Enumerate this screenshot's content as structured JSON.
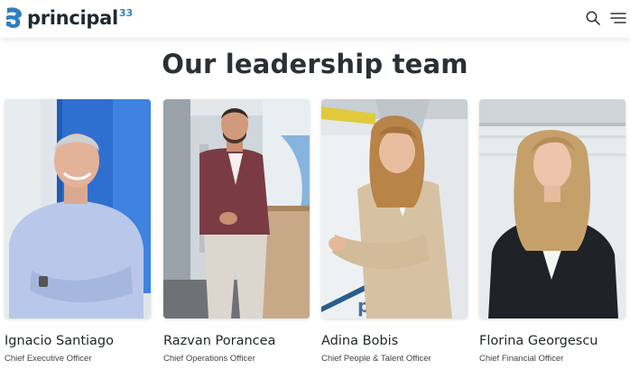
{
  "header": {
    "logo_text": "principal",
    "logo_sup": "33"
  },
  "section": {
    "title": "Our leadership team"
  },
  "team": [
    {
      "name": "Ignacio Santiago",
      "role": "Chief Executive Officer"
    },
    {
      "name": "Razvan Porancea",
      "role": "Chief Operations Officer"
    },
    {
      "name": "Adina Bobis",
      "role": "Chief People & Talent Officer"
    },
    {
      "name": "Florina Georgescu",
      "role": "Chief Financial Officer"
    }
  ],
  "colors": {
    "brand_blue": "#2f7fc1",
    "heading": "#2a3034"
  },
  "icons": [
    "logo-mark-icon",
    "search-icon",
    "menu-icon"
  ]
}
